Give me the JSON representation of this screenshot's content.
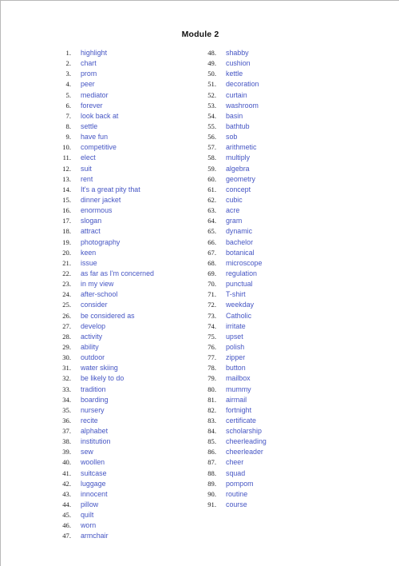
{
  "document": {
    "title": "Module 2",
    "accent_color": "#4656c4",
    "number_color": "#1b1b1b",
    "background_color": "#ffffff",
    "page_border_color": "#b8b8b8"
  },
  "columns": [
    {
      "name": "left-column",
      "items": [
        {
          "number": "1.",
          "term": "highlight"
        },
        {
          "number": "2.",
          "term": "chart"
        },
        {
          "number": "3.",
          "term": "prom"
        },
        {
          "number": "4.",
          "term": "peer"
        },
        {
          "number": "5.",
          "term": "mediator"
        },
        {
          "number": "6.",
          "term": "forever"
        },
        {
          "number": "7.",
          "term": "look back at"
        },
        {
          "number": "8.",
          "term": "settle"
        },
        {
          "number": "9.",
          "term": "have fun"
        },
        {
          "number": "10.",
          "term": "competitive"
        },
        {
          "number": "11.",
          "term": "elect"
        },
        {
          "number": "12.",
          "term": "suit"
        },
        {
          "number": "13.",
          "term": "rent"
        },
        {
          "number": "14.",
          "term": "It's a great pity that"
        },
        {
          "number": "15.",
          "term": "dinner jacket"
        },
        {
          "number": "16.",
          "term": "enormous"
        },
        {
          "number": "17.",
          "term": "slogan"
        },
        {
          "number": "18.",
          "term": "attract"
        },
        {
          "number": "19.",
          "term": "photography"
        },
        {
          "number": "20.",
          "term": "keen"
        },
        {
          "number": "21.",
          "term": "issue"
        },
        {
          "number": "22.",
          "term": "as far as I'm concerned"
        },
        {
          "number": "23.",
          "term": "in my view"
        },
        {
          "number": "24.",
          "term": "after-school"
        },
        {
          "number": "25.",
          "term": "consider"
        },
        {
          "number": "26.",
          "term": "be considered as"
        },
        {
          "number": "27.",
          "term": "develop"
        },
        {
          "number": "28.",
          "term": "activity"
        },
        {
          "number": "29.",
          "term": "ability"
        },
        {
          "number": "30.",
          "term": "outdoor"
        },
        {
          "number": "31.",
          "term": "water skiing"
        },
        {
          "number": "32.",
          "term": "be likely to do"
        },
        {
          "number": "33.",
          "term": "tradition"
        },
        {
          "number": "34.",
          "term": "boarding"
        },
        {
          "number": "35.",
          "term": "nursery"
        },
        {
          "number": "36.",
          "term": "recite"
        },
        {
          "number": "37.",
          "term": "alphabet"
        },
        {
          "number": "38.",
          "term": "institution"
        },
        {
          "number": "39.",
          "term": "sew"
        },
        {
          "number": "40.",
          "term": "woollen"
        },
        {
          "number": "41.",
          "term": "suitcase"
        },
        {
          "number": "42.",
          "term": "luggage"
        },
        {
          "number": "43.",
          "term": "innocent"
        },
        {
          "number": "44.",
          "term": "pillow"
        },
        {
          "number": "45.",
          "term": "quilt"
        },
        {
          "number": "46.",
          "term": "worn"
        },
        {
          "number": "47.",
          "term": "armchair"
        }
      ]
    },
    {
      "name": "right-column",
      "items": [
        {
          "number": "48.",
          "term": "shabby"
        },
        {
          "number": "49.",
          "term": "cushion"
        },
        {
          "number": "50.",
          "term": "kettle"
        },
        {
          "number": "51.",
          "term": "decoration"
        },
        {
          "number": "52.",
          "term": "curtain"
        },
        {
          "number": "53.",
          "term": "washroom"
        },
        {
          "number": "54.",
          "term": "basin"
        },
        {
          "number": "55.",
          "term": "bathtub"
        },
        {
          "number": "56.",
          "term": "sob"
        },
        {
          "number": "57.",
          "term": "arithmetic"
        },
        {
          "number": "58.",
          "term": "multiply"
        },
        {
          "number": "59.",
          "term": "algebra"
        },
        {
          "number": "60.",
          "term": "geometry"
        },
        {
          "number": "61.",
          "term": "concept"
        },
        {
          "number": "62.",
          "term": "cubic"
        },
        {
          "number": "63.",
          "term": "acre"
        },
        {
          "number": "64.",
          "term": "gram"
        },
        {
          "number": "65.",
          "term": "dynamic"
        },
        {
          "number": "66.",
          "term": "bachelor"
        },
        {
          "number": "67.",
          "term": "botanical"
        },
        {
          "number": "68.",
          "term": "microscope"
        },
        {
          "number": "69.",
          "term": "regulation"
        },
        {
          "number": "70.",
          "term": "punctual"
        },
        {
          "number": "71.",
          "term": "T-shirt"
        },
        {
          "number": "72.",
          "term": "weekday"
        },
        {
          "number": "73.",
          "term": "Catholic"
        },
        {
          "number": "74.",
          "term": "irritate"
        },
        {
          "number": "75.",
          "term": "upset"
        },
        {
          "number": "76.",
          "term": "polish"
        },
        {
          "number": "77.",
          "term": "zipper"
        },
        {
          "number": "78.",
          "term": "button"
        },
        {
          "number": "79.",
          "term": "mailbox"
        },
        {
          "number": "80.",
          "term": "mummy"
        },
        {
          "number": "81.",
          "term": "airmail"
        },
        {
          "number": "82.",
          "term": "fortnight"
        },
        {
          "number": "83.",
          "term": "certificate"
        },
        {
          "number": "84.",
          "term": "scholarship"
        },
        {
          "number": "85.",
          "term": "cheerleading"
        },
        {
          "number": "86.",
          "term": "cheerleader"
        },
        {
          "number": "87.",
          "term": "cheer"
        },
        {
          "number": "88.",
          "term": "squad"
        },
        {
          "number": "89.",
          "term": "pompom"
        },
        {
          "number": "90.",
          "term": "routine"
        },
        {
          "number": "91.",
          "term": "course"
        }
      ]
    }
  ]
}
